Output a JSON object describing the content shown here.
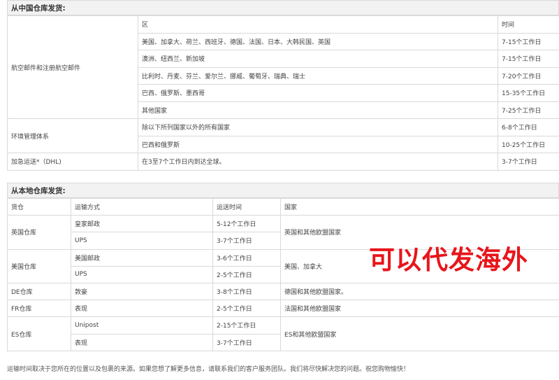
{
  "china_section": {
    "title": "从中国仓库发货:",
    "header": {
      "region": "区",
      "time": "时间"
    },
    "air_mail_label": "航空邮件和注册航空邮件",
    "air_mail_rows": [
      {
        "region": "美国、加拿大、荷兰、西班牙、德国、法国、日本、大韩民国、英国",
        "time": "7-15个工作日"
      },
      {
        "region": "澳洲、纽西兰、新加坡",
        "time": "7-15个工作日"
      },
      {
        "region": "比利时、丹麦、芬兰、爱尔兰、挪威、葡萄牙、瑞典、瑞士",
        "time": "7-20个工作日"
      },
      {
        "region": "巴西、俄罗斯、墨西哥",
        "time": "15-35个工作日"
      },
      {
        "region": "其他国家",
        "time": "7-25个工作日"
      }
    ],
    "ems_label": "环境管理体系",
    "ems_rows": [
      {
        "region": "除以下所列国家以外的所有国家",
        "time": "6-8个工作日"
      },
      {
        "region": "巴西和俄罗斯",
        "time": "10-25个工作日"
      }
    ],
    "dhl": {
      "label": "加急运送*（DHL)",
      "region": "在3至7个工作日内到达全球。",
      "time": "3-7个工作日"
    }
  },
  "local_section": {
    "title": "从本地仓库发货:",
    "headers": {
      "warehouse": "货仓",
      "method": "运输方式",
      "time": "运送时间",
      "country": "国家"
    },
    "uk": {
      "warehouse": "英国仓库",
      "rows": [
        {
          "method": "皇家邮政",
          "time": "5-12个工作日"
        },
        {
          "method": "UPS",
          "time": "3-7个工作日"
        }
      ],
      "country": "英国和其他欧盟国家"
    },
    "us": {
      "warehouse": "美国仓库",
      "rows": [
        {
          "method": "美国邮政",
          "time": "3-6个工作日"
        },
        {
          "method": "UPS",
          "time": "2-5个工作日"
        }
      ],
      "country": "美国、加拿大"
    },
    "de": {
      "warehouse": "DE仓库",
      "method": "敦豪",
      "time": "3-8个工作日",
      "country": "德国和其他欧盟国家。"
    },
    "fr": {
      "warehouse": "FR仓库",
      "method": "表现",
      "time": "2-5个工作日",
      "country": "法国和其他欧盟国家"
    },
    "es": {
      "warehouse": "ES仓库",
      "rows": [
        {
          "method": "Unipost",
          "time": "2-15个工作日"
        },
        {
          "method": "表现",
          "time": "3-7个工作日"
        }
      ],
      "country": "ES和其他欧盟国家"
    }
  },
  "promo_text": "可以代发海外",
  "footer_note": "运输时间取决于您所在的位置以及包裹的来源。如果您想了解更多信息，请联系我们的客户服务团队。我们将尽快解决您的问题。祝您购物愉快！",
  "colors": {
    "border": "#d9d9d9",
    "title_bg": "#f2f2f2",
    "promo": "#e8151b"
  }
}
